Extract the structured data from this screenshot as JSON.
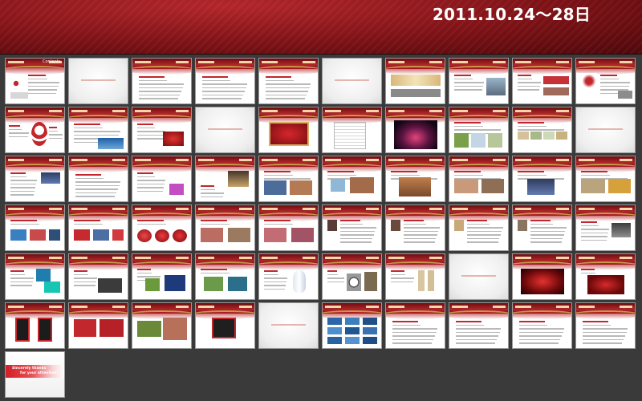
{
  "header": {
    "date_text": "2011.10.24～28日"
  },
  "first_slide": {
    "title": "Contents"
  },
  "last_slide": {
    "line1": "Sincerely thanks",
    "line2": "for your attention!"
  },
  "colors": {
    "brand_red": "#b1262a",
    "dark_red": "#6c0d10",
    "background": "#3a3a3a",
    "gold": "#c89a4a"
  },
  "slides": [
    {
      "type": "contents"
    },
    {
      "type": "section"
    },
    {
      "type": "text"
    },
    {
      "type": "text"
    },
    {
      "type": "text"
    },
    {
      "type": "section"
    },
    {
      "type": "image",
      "variant": "banner"
    },
    {
      "type": "image",
      "variant": "text-photo"
    },
    {
      "type": "image",
      "variant": "photos"
    },
    {
      "type": "image",
      "variant": "logo"
    },
    {
      "type": "image",
      "variant": "number"
    },
    {
      "type": "image",
      "variant": "photo-bottom"
    },
    {
      "type": "image",
      "variant": "red-box"
    },
    {
      "type": "section"
    },
    {
      "type": "image",
      "variant": "red-center"
    },
    {
      "type": "image",
      "variant": "table"
    },
    {
      "type": "image",
      "variant": "stage"
    },
    {
      "type": "image",
      "variant": "photos3"
    },
    {
      "type": "image",
      "variant": "photos4"
    },
    {
      "type": "section"
    },
    {
      "type": "image",
      "variant": "photo-right"
    },
    {
      "type": "text"
    },
    {
      "type": "image",
      "variant": "photo-small"
    },
    {
      "type": "image",
      "variant": "photo-mid"
    },
    {
      "type": "image",
      "variant": "photos2"
    },
    {
      "type": "image",
      "variant": "photos2b"
    },
    {
      "type": "image",
      "variant": "photo-people"
    },
    {
      "type": "image",
      "variant": "photos2c"
    },
    {
      "type": "image",
      "variant": "photo-center"
    },
    {
      "type": "image",
      "variant": "photos2d"
    },
    {
      "type": "image",
      "variant": "photos2e"
    },
    {
      "type": "image",
      "variant": "photos3b"
    },
    {
      "type": "image",
      "variant": "flowers"
    },
    {
      "type": "image",
      "variant": "photos2f"
    },
    {
      "type": "image",
      "variant": "photos2g"
    },
    {
      "type": "image",
      "variant": "portrait"
    },
    {
      "type": "image",
      "variant": "portrait2"
    },
    {
      "type": "image",
      "variant": "portrait3"
    },
    {
      "type": "image",
      "variant": "portrait4"
    },
    {
      "type": "image",
      "variant": "photo-right2"
    },
    {
      "type": "image",
      "variant": "photo-cyan"
    },
    {
      "type": "image",
      "variant": "photo-room"
    },
    {
      "type": "image",
      "variant": "photos-green"
    },
    {
      "type": "image",
      "variant": "photos-teal"
    },
    {
      "type": "image",
      "variant": "vase"
    },
    {
      "type": "image",
      "variant": "clock"
    },
    {
      "type": "image",
      "variant": "scroll"
    },
    {
      "type": "section"
    },
    {
      "type": "image",
      "variant": "red-glow"
    },
    {
      "type": "image",
      "variant": "red-glow2"
    },
    {
      "type": "image",
      "variant": "red-panels"
    },
    {
      "type": "image",
      "variant": "red-banners"
    },
    {
      "type": "image",
      "variant": "photos-kids"
    },
    {
      "type": "image",
      "variant": "dark-panels"
    },
    {
      "type": "section"
    },
    {
      "type": "image",
      "variant": "grid-photos"
    },
    {
      "type": "text"
    },
    {
      "type": "text"
    },
    {
      "type": "text"
    },
    {
      "type": "text"
    },
    {
      "type": "thanks"
    }
  ]
}
